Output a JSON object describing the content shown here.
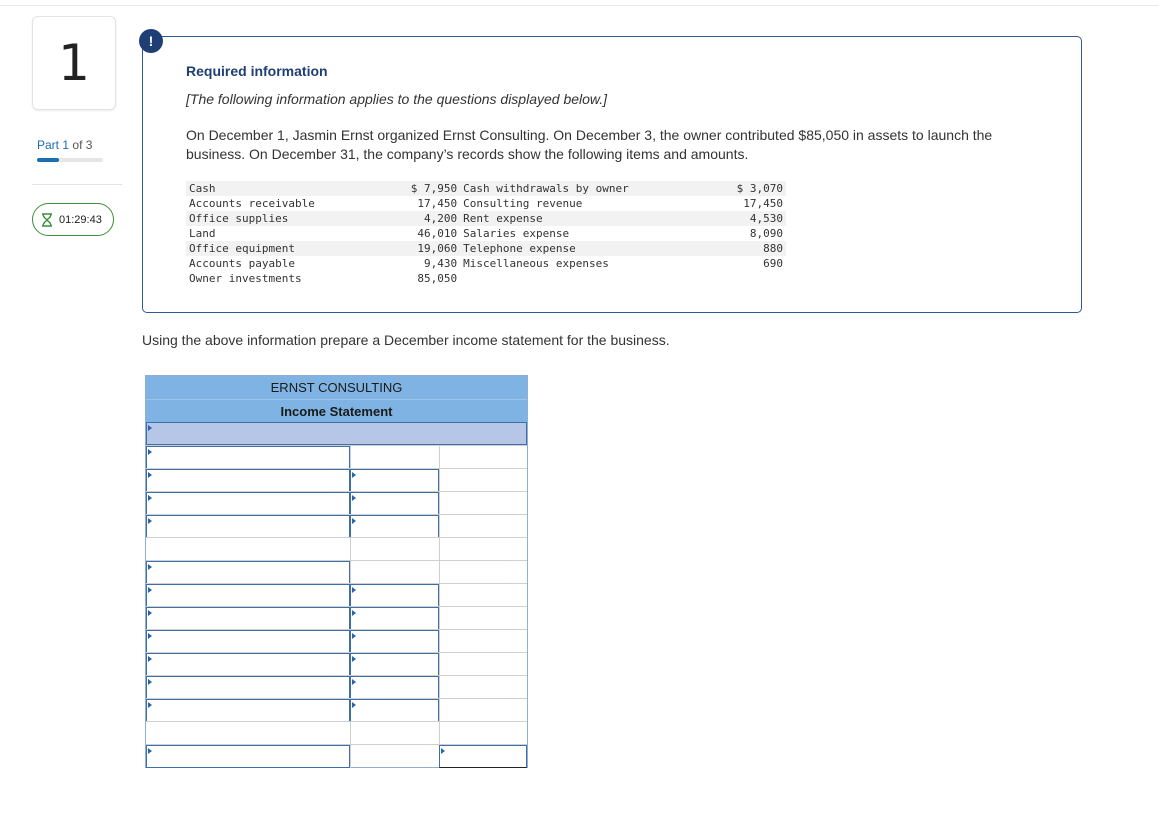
{
  "question": {
    "number": "1"
  },
  "part": {
    "word": "Part",
    "current": "1",
    "of_total": "of 3",
    "progress": 0.333
  },
  "timer": {
    "value": "01:29:43",
    "icon": "hourglass-icon",
    "color": "#3a8f3a"
  },
  "alert": {
    "glyph": "!",
    "icon": "alert-icon",
    "color": "#1f3f74"
  },
  "info": {
    "title": "Required information",
    "subtitle": "[The following information applies to the questions displayed below.]",
    "paragraph": "On December 1, Jasmin Ernst organized Ernst Consulting. On December 3, the owner contributed $85,050 in assets to launch the business. On December 31, the company’s records show the following items and amounts.",
    "items": [
      {
        "label1": "Cash",
        "value1": "$ 7,950",
        "label2": "Cash withdrawals by owner",
        "value2": "$ 3,070"
      },
      {
        "label1": "Accounts receivable",
        "value1": "17,450",
        "label2": "Consulting revenue",
        "value2": "17,450"
      },
      {
        "label1": "Office supplies",
        "value1": "4,200",
        "label2": "Rent expense",
        "value2": "4,530"
      },
      {
        "label1": "Land",
        "value1": "46,010",
        "label2": "Salaries expense",
        "value2": "8,090"
      },
      {
        "label1": "Office equipment",
        "value1": "19,060",
        "label2": "Telephone expense",
        "value2": "880"
      },
      {
        "label1": "Accounts payable",
        "value1": "9,430",
        "label2": "Miscellaneous expenses",
        "value2": "690"
      },
      {
        "label1": "Owner investments",
        "value1": "85,050",
        "label2": "",
        "value2": ""
      }
    ]
  },
  "instruction": "Using the above information prepare a December income statement for the business.",
  "statement": {
    "company": "ERNST CONSULTING",
    "title": "Income Statement",
    "date_value": "",
    "rows": [
      {
        "label": "",
        "amount": "",
        "total": ""
      },
      {
        "label": "",
        "amount": "",
        "total": ""
      },
      {
        "label": "",
        "amount": "",
        "total": ""
      },
      {
        "label": "",
        "amount": "",
        "total": ""
      },
      {
        "label": "",
        "amount": "",
        "total": ""
      },
      {
        "label": "",
        "amount": "",
        "total": ""
      },
      {
        "label": "",
        "amount": "",
        "total": ""
      },
      {
        "label": "",
        "amount": "",
        "total": ""
      },
      {
        "label": "",
        "amount": "",
        "total": ""
      },
      {
        "label": "",
        "amount": "",
        "total": ""
      },
      {
        "label": "",
        "amount": "",
        "total": ""
      },
      {
        "label": "",
        "amount": "",
        "total": ""
      },
      {
        "label": "",
        "amount": "",
        "total": ""
      },
      {
        "label": "",
        "amount": "",
        "total": ""
      }
    ]
  },
  "colors": {
    "header_blue": "#7fb3e3",
    "date_row": "#b6c6e6",
    "input_border": "#3f6ea8",
    "info_border": "#2e5a8e"
  }
}
